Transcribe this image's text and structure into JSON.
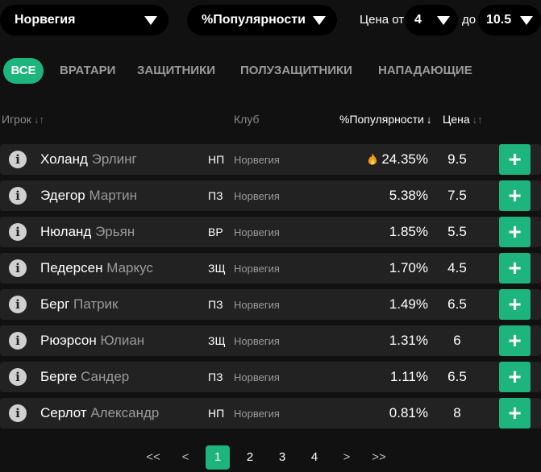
{
  "filters": {
    "country": "Норвегия",
    "sort": "%Популярности",
    "price_from_label": "Цена от",
    "price_from": "4",
    "price_to_label": "до",
    "price_to": "10.5"
  },
  "tabs": [
    "ВСЕ",
    "ВРАТАРИ",
    "ЗАЩИТНИКИ",
    "ПОЛУЗАЩИТНИКИ",
    "НАПАДАЮЩИЕ"
  ],
  "active_tab": "ВСЕ",
  "columns": {
    "player": "Игрок",
    "club": "Клуб",
    "popularity": "%Популярности",
    "price": "Цена"
  },
  "players": [
    {
      "last": "Холанд",
      "first": "Эрлинг",
      "pos": "НП",
      "club": "Норвегия",
      "pop": "24.35%",
      "price": "9.5",
      "hot": true
    },
    {
      "last": "Эдегор",
      "first": "Мартин",
      "pos": "ПЗ",
      "club": "Норвегия",
      "pop": "5.38%",
      "price": "7.5",
      "hot": false
    },
    {
      "last": "Нюланд",
      "first": "Эрьян",
      "pos": "ВР",
      "club": "Норвегия",
      "pop": "1.85%",
      "price": "5.5",
      "hot": false
    },
    {
      "last": "Педерсен",
      "first": "Маркус",
      "pos": "ЗЩ",
      "club": "Норвегия",
      "pop": "1.70%",
      "price": "4.5",
      "hot": false
    },
    {
      "last": "Берг",
      "first": "Патрик",
      "pos": "ПЗ",
      "club": "Норвегия",
      "pop": "1.49%",
      "price": "6.5",
      "hot": false
    },
    {
      "last": "Рюэрсон",
      "first": "Юлиан",
      "pos": "ЗЩ",
      "club": "Норвегия",
      "pop": "1.31%",
      "price": "6",
      "hot": false
    },
    {
      "last": "Берге",
      "first": "Сандер",
      "pos": "ПЗ",
      "club": "Норвегия",
      "pop": "1.11%",
      "price": "6.5",
      "hot": false
    },
    {
      "last": "Серлот",
      "first": "Александр",
      "pos": "НП",
      "club": "Норвегия",
      "pop": "0.81%",
      "price": "8",
      "hot": false
    }
  ],
  "pagination": {
    "first": "<<",
    "prev": "<",
    "pages": [
      "1",
      "2",
      "3",
      "4"
    ],
    "current": "1",
    "next": ">",
    "last": ">>"
  },
  "colors": {
    "accent": "#1db47d",
    "row_bg": "#222222",
    "page_bg": "#111111"
  }
}
